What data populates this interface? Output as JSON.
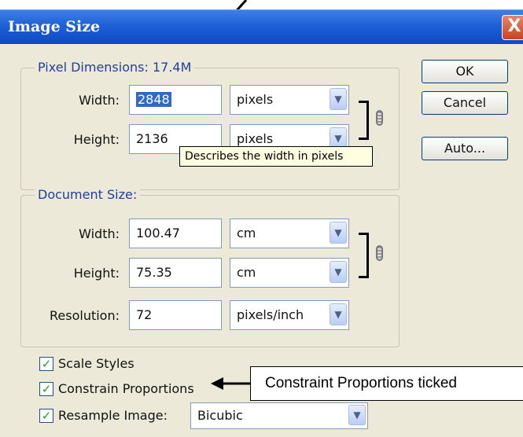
{
  "window": {
    "title": "Image Size",
    "close_glyph": "X"
  },
  "pixel_dimensions": {
    "label": "Pixel Dimensions:",
    "size": "17.4M",
    "width_label": "Width:",
    "width_value": "2848",
    "width_unit": "pixels",
    "height_label": "Height:",
    "height_value": "2136",
    "height_unit": "pixels"
  },
  "tooltip": "Describes the width in pixels",
  "document_size": {
    "label": "Document Size:",
    "width_label": "Width:",
    "width_value": "100.47",
    "width_unit": "cm",
    "height_label": "Height:",
    "height_value": "75.35",
    "height_unit": "cm",
    "resolution_label": "Resolution:",
    "resolution_value": "72",
    "resolution_unit": "pixels/inch"
  },
  "buttons": {
    "ok": "OK",
    "cancel": "Cancel",
    "auto": "Auto..."
  },
  "options": {
    "scale_styles": "Scale Styles",
    "scale_styles_checked": true,
    "constrain_proportions": "Constrain Proportions",
    "constrain_proportions_checked": true,
    "resample_image": "Resample Image:",
    "resample_image_checked": true,
    "resample_method": "Bicubic"
  },
  "annotation": {
    "callout_text": "Constraint Proportions ticked"
  },
  "icons": {
    "dropdown": "chevron-down-icon",
    "check": "checkmark-icon",
    "link": "chain-link-icon"
  },
  "colors": {
    "titlebar": "#0b49c4",
    "dialog_bg": "#ece9d8",
    "group_label": "#1f3f9f",
    "tooltip_bg": "#ffffe1"
  }
}
